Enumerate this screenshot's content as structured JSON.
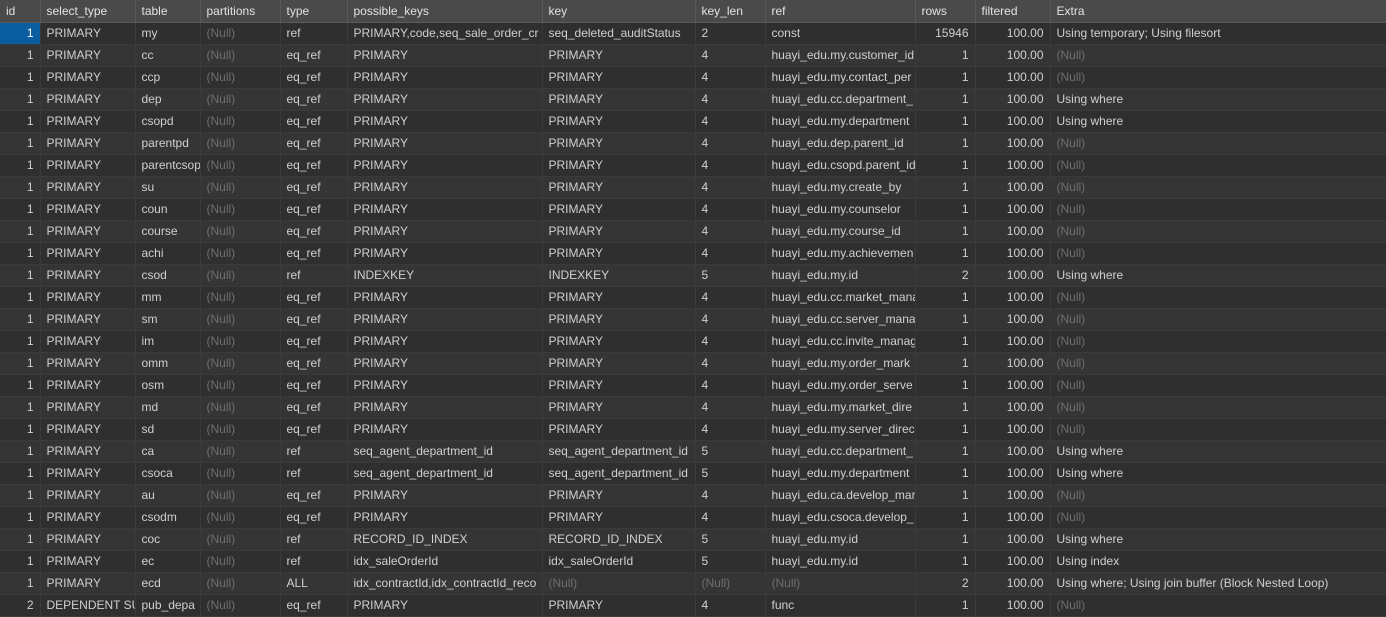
{
  "columns": [
    "id",
    "select_type",
    "table",
    "partitions",
    "type",
    "possible_keys",
    "key",
    "key_len",
    "ref",
    "rows",
    "filtered",
    "Extra"
  ],
  "rows": [
    {
      "id": 1,
      "select_type": "PRIMARY",
      "table": "my",
      "partitions": null,
      "type": "ref",
      "possible_keys": "PRIMARY,code,seq_sale_order_cr",
      "key": "seq_deleted_auditStatus",
      "key_len": "2",
      "ref": "const",
      "rows": 15946,
      "filtered": "100.00",
      "extra": "Using temporary; Using filesort"
    },
    {
      "id": 1,
      "select_type": "PRIMARY",
      "table": "cc",
      "partitions": null,
      "type": "eq_ref",
      "possible_keys": "PRIMARY",
      "key": "PRIMARY",
      "key_len": "4",
      "ref": "huayi_edu.my.customer_id",
      "rows": 1,
      "filtered": "100.00",
      "extra": null
    },
    {
      "id": 1,
      "select_type": "PRIMARY",
      "table": "ccp",
      "partitions": null,
      "type": "eq_ref",
      "possible_keys": "PRIMARY",
      "key": "PRIMARY",
      "key_len": "4",
      "ref": "huayi_edu.my.contact_per",
      "rows": 1,
      "filtered": "100.00",
      "extra": null
    },
    {
      "id": 1,
      "select_type": "PRIMARY",
      "table": "dep",
      "partitions": null,
      "type": "eq_ref",
      "possible_keys": "PRIMARY",
      "key": "PRIMARY",
      "key_len": "4",
      "ref": "huayi_edu.cc.department_",
      "rows": 1,
      "filtered": "100.00",
      "extra": "Using where"
    },
    {
      "id": 1,
      "select_type": "PRIMARY",
      "table": "csopd",
      "partitions": null,
      "type": "eq_ref",
      "possible_keys": "PRIMARY",
      "key": "PRIMARY",
      "key_len": "4",
      "ref": "huayi_edu.my.department",
      "rows": 1,
      "filtered": "100.00",
      "extra": "Using where"
    },
    {
      "id": 1,
      "select_type": "PRIMARY",
      "table": "parentpd",
      "partitions": null,
      "type": "eq_ref",
      "possible_keys": "PRIMARY",
      "key": "PRIMARY",
      "key_len": "4",
      "ref": "huayi_edu.dep.parent_id",
      "rows": 1,
      "filtered": "100.00",
      "extra": null
    },
    {
      "id": 1,
      "select_type": "PRIMARY",
      "table": "parentcsop",
      "partitions": null,
      "type": "eq_ref",
      "possible_keys": "PRIMARY",
      "key": "PRIMARY",
      "key_len": "4",
      "ref": "huayi_edu.csopd.parent_id",
      "rows": 1,
      "filtered": "100.00",
      "extra": null
    },
    {
      "id": 1,
      "select_type": "PRIMARY",
      "table": "su",
      "partitions": null,
      "type": "eq_ref",
      "possible_keys": "PRIMARY",
      "key": "PRIMARY",
      "key_len": "4",
      "ref": "huayi_edu.my.create_by",
      "rows": 1,
      "filtered": "100.00",
      "extra": null
    },
    {
      "id": 1,
      "select_type": "PRIMARY",
      "table": "coun",
      "partitions": null,
      "type": "eq_ref",
      "possible_keys": "PRIMARY",
      "key": "PRIMARY",
      "key_len": "4",
      "ref": "huayi_edu.my.counselor",
      "rows": 1,
      "filtered": "100.00",
      "extra": null
    },
    {
      "id": 1,
      "select_type": "PRIMARY",
      "table": "course",
      "partitions": null,
      "type": "eq_ref",
      "possible_keys": "PRIMARY",
      "key": "PRIMARY",
      "key_len": "4",
      "ref": "huayi_edu.my.course_id",
      "rows": 1,
      "filtered": "100.00",
      "extra": null
    },
    {
      "id": 1,
      "select_type": "PRIMARY",
      "table": "achi",
      "partitions": null,
      "type": "eq_ref",
      "possible_keys": "PRIMARY",
      "key": "PRIMARY",
      "key_len": "4",
      "ref": "huayi_edu.my.achievemen",
      "rows": 1,
      "filtered": "100.00",
      "extra": null
    },
    {
      "id": 1,
      "select_type": "PRIMARY",
      "table": "csod",
      "partitions": null,
      "type": "ref",
      "possible_keys": "INDEXKEY",
      "key": "INDEXKEY",
      "key_len": "5",
      "ref": "huayi_edu.my.id",
      "rows": 2,
      "filtered": "100.00",
      "extra": "Using where"
    },
    {
      "id": 1,
      "select_type": "PRIMARY",
      "table": "mm",
      "partitions": null,
      "type": "eq_ref",
      "possible_keys": "PRIMARY",
      "key": "PRIMARY",
      "key_len": "4",
      "ref": "huayi_edu.cc.market_mana",
      "rows": 1,
      "filtered": "100.00",
      "extra": null
    },
    {
      "id": 1,
      "select_type": "PRIMARY",
      "table": "sm",
      "partitions": null,
      "type": "eq_ref",
      "possible_keys": "PRIMARY",
      "key": "PRIMARY",
      "key_len": "4",
      "ref": "huayi_edu.cc.server_mana",
      "rows": 1,
      "filtered": "100.00",
      "extra": null
    },
    {
      "id": 1,
      "select_type": "PRIMARY",
      "table": "im",
      "partitions": null,
      "type": "eq_ref",
      "possible_keys": "PRIMARY",
      "key": "PRIMARY",
      "key_len": "4",
      "ref": "huayi_edu.cc.invite_manag",
      "rows": 1,
      "filtered": "100.00",
      "extra": null
    },
    {
      "id": 1,
      "select_type": "PRIMARY",
      "table": "omm",
      "partitions": null,
      "type": "eq_ref",
      "possible_keys": "PRIMARY",
      "key": "PRIMARY",
      "key_len": "4",
      "ref": "huayi_edu.my.order_mark",
      "rows": 1,
      "filtered": "100.00",
      "extra": null
    },
    {
      "id": 1,
      "select_type": "PRIMARY",
      "table": "osm",
      "partitions": null,
      "type": "eq_ref",
      "possible_keys": "PRIMARY",
      "key": "PRIMARY",
      "key_len": "4",
      "ref": "huayi_edu.my.order_serve",
      "rows": 1,
      "filtered": "100.00",
      "extra": null
    },
    {
      "id": 1,
      "select_type": "PRIMARY",
      "table": "md",
      "partitions": null,
      "type": "eq_ref",
      "possible_keys": "PRIMARY",
      "key": "PRIMARY",
      "key_len": "4",
      "ref": "huayi_edu.my.market_dire",
      "rows": 1,
      "filtered": "100.00",
      "extra": null
    },
    {
      "id": 1,
      "select_type": "PRIMARY",
      "table": "sd",
      "partitions": null,
      "type": "eq_ref",
      "possible_keys": "PRIMARY",
      "key": "PRIMARY",
      "key_len": "4",
      "ref": "huayi_edu.my.server_direc",
      "rows": 1,
      "filtered": "100.00",
      "extra": null
    },
    {
      "id": 1,
      "select_type": "PRIMARY",
      "table": "ca",
      "partitions": null,
      "type": "ref",
      "possible_keys": "seq_agent_department_id",
      "key": "seq_agent_department_id",
      "key_len": "5",
      "ref": "huayi_edu.cc.department_",
      "rows": 1,
      "filtered": "100.00",
      "extra": "Using where"
    },
    {
      "id": 1,
      "select_type": "PRIMARY",
      "table": "csoca",
      "partitions": null,
      "type": "ref",
      "possible_keys": "seq_agent_department_id",
      "key": "seq_agent_department_id",
      "key_len": "5",
      "ref": "huayi_edu.my.department",
      "rows": 1,
      "filtered": "100.00",
      "extra": "Using where"
    },
    {
      "id": 1,
      "select_type": "PRIMARY",
      "table": "au",
      "partitions": null,
      "type": "eq_ref",
      "possible_keys": "PRIMARY",
      "key": "PRIMARY",
      "key_len": "4",
      "ref": "huayi_edu.ca.develop_mar",
      "rows": 1,
      "filtered": "100.00",
      "extra": null
    },
    {
      "id": 1,
      "select_type": "PRIMARY",
      "table": "csodm",
      "partitions": null,
      "type": "eq_ref",
      "possible_keys": "PRIMARY",
      "key": "PRIMARY",
      "key_len": "4",
      "ref": "huayi_edu.csoca.develop_",
      "rows": 1,
      "filtered": "100.00",
      "extra": null
    },
    {
      "id": 1,
      "select_type": "PRIMARY",
      "table": "coc",
      "partitions": null,
      "type": "ref",
      "possible_keys": "RECORD_ID_INDEX",
      "key": "RECORD_ID_INDEX",
      "key_len": "5",
      "ref": "huayi_edu.my.id",
      "rows": 1,
      "filtered": "100.00",
      "extra": "Using where"
    },
    {
      "id": 1,
      "select_type": "PRIMARY",
      "table": "ec",
      "partitions": null,
      "type": "ref",
      "possible_keys": "idx_saleOrderId",
      "key": "idx_saleOrderId",
      "key_len": "5",
      "ref": "huayi_edu.my.id",
      "rows": 1,
      "filtered": "100.00",
      "extra": "Using index"
    },
    {
      "id": 1,
      "select_type": "PRIMARY",
      "table": "ecd",
      "partitions": null,
      "type": "ALL",
      "possible_keys": "idx_contractId,idx_contractId_reco",
      "key": null,
      "key_len": null,
      "ref": null,
      "rows": 2,
      "filtered": "100.00",
      "extra": "Using where; Using join buffer (Block Nested Loop)"
    },
    {
      "id": 2,
      "select_type": "DEPENDENT SU",
      "table": "pub_depa",
      "partitions": null,
      "type": "eq_ref",
      "possible_keys": "PRIMARY",
      "key": "PRIMARY",
      "key_len": "4",
      "ref": "func",
      "rows": 1,
      "filtered": "100.00",
      "extra": null
    }
  ]
}
